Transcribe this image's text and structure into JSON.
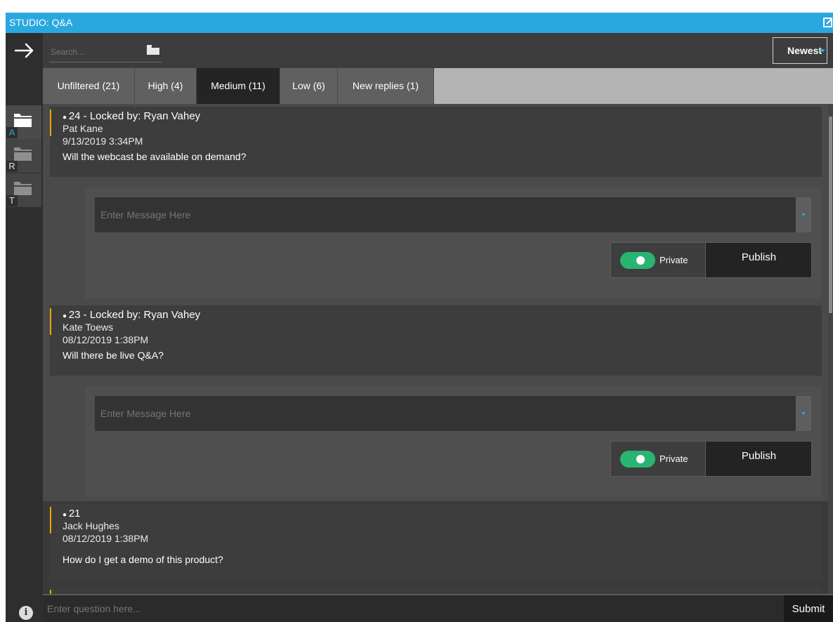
{
  "window": {
    "title": "STUDIO: Q&A"
  },
  "toolbar": {
    "search_placeholder": "Search...",
    "sort_label": "Newest"
  },
  "nav": {
    "items": [
      {
        "letter": "A"
      },
      {
        "letter": "R"
      },
      {
        "letter": "T"
      }
    ]
  },
  "tabs": [
    {
      "label": "Unfiltered (21)"
    },
    {
      "label": "High (4)"
    },
    {
      "label": "Medium (11)"
    },
    {
      "label": "Low (6)"
    },
    {
      "label": "New replies (1)"
    }
  ],
  "questions": [
    {
      "id": "24 - Locked by: Ryan Vahey",
      "author": "Pat Kane",
      "date": "9/13/2019 3:34PM",
      "text": "Will the webcast be available on demand?"
    },
    {
      "id": "23 - Locked by: Ryan Vahey",
      "author": "Kate Toews",
      "date": "08/12/2019 1:38PM",
      "text": "Will there be live Q&A?"
    },
    {
      "id": "21",
      "author": "Jack Hughes",
      "date": "08/12/2019 1:38PM",
      "text": "How do I get a demo of this product?"
    }
  ],
  "reply": {
    "placeholder": "Enter Message Here",
    "private_label": "Private",
    "publish_label": "Publish"
  },
  "bottom": {
    "placeholder": "Enter question here...",
    "submit_label": "Submit"
  },
  "colors": {
    "accent": "#29a8df",
    "toggle": "#2ab471",
    "marker": "#f0a500"
  }
}
